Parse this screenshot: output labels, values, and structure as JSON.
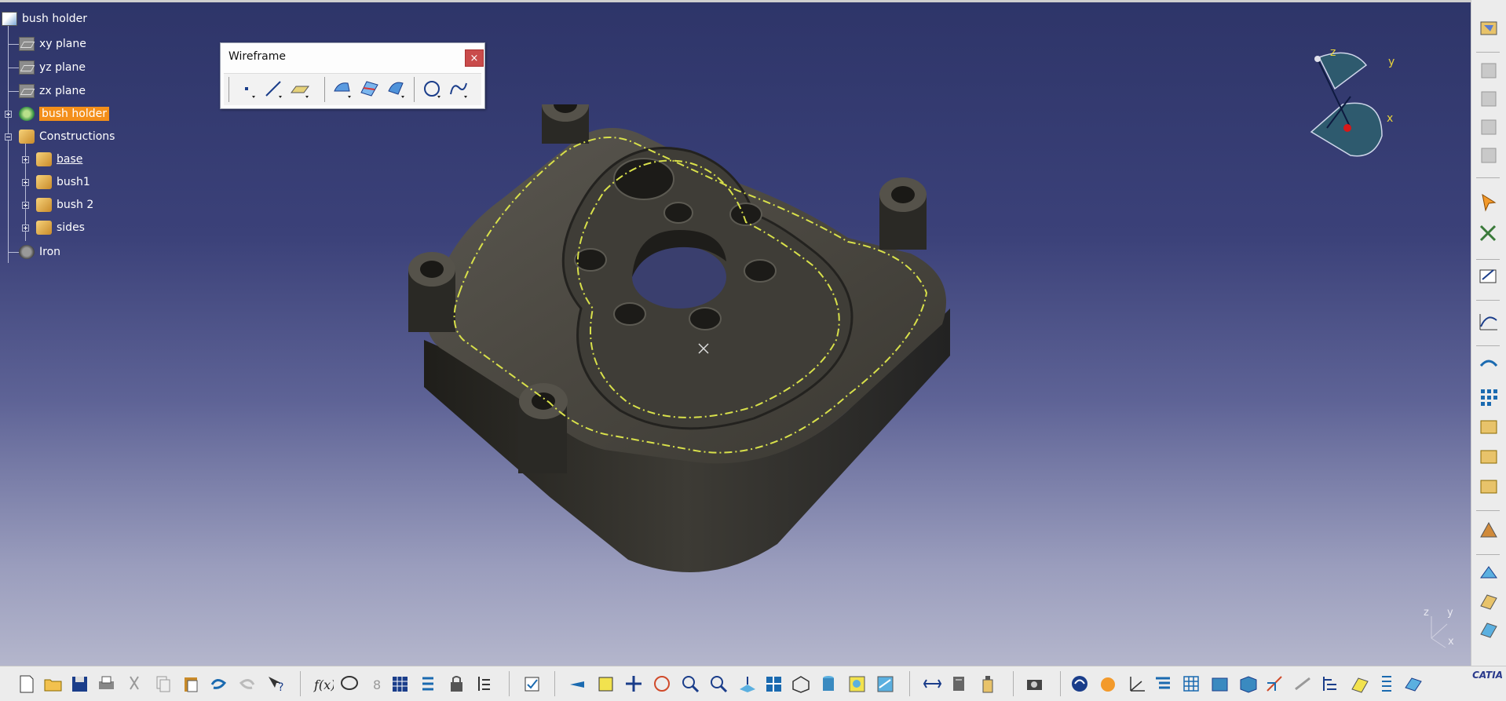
{
  "tree": {
    "root": "bush holder",
    "planes": [
      "xy plane",
      "yz plane",
      "zx plane"
    ],
    "part_body": "bush holder",
    "constructions": "Constructions",
    "bodies": [
      "base",
      "bush1",
      "bush 2",
      "sides"
    ],
    "material": "Iron"
  },
  "wireframe": {
    "title": "Wireframe",
    "close": "×",
    "tools": [
      "point-icon",
      "line-icon",
      "plane-icon",
      "projection-icon",
      "intersection-icon",
      "offset-icon",
      "circle-icon",
      "spline-icon"
    ]
  },
  "compass": {
    "z": "z",
    "y": "y",
    "x": "x"
  },
  "triad": {
    "z": "z",
    "y": "y",
    "x": "x"
  },
  "colors": {
    "viewport_top": "#2e3569",
    "viewport_bottom": "#b4b6cc",
    "selection": "#f38f1a",
    "part": "#4a4740",
    "edge": "#d8e04a"
  },
  "logo": "CATIA"
}
